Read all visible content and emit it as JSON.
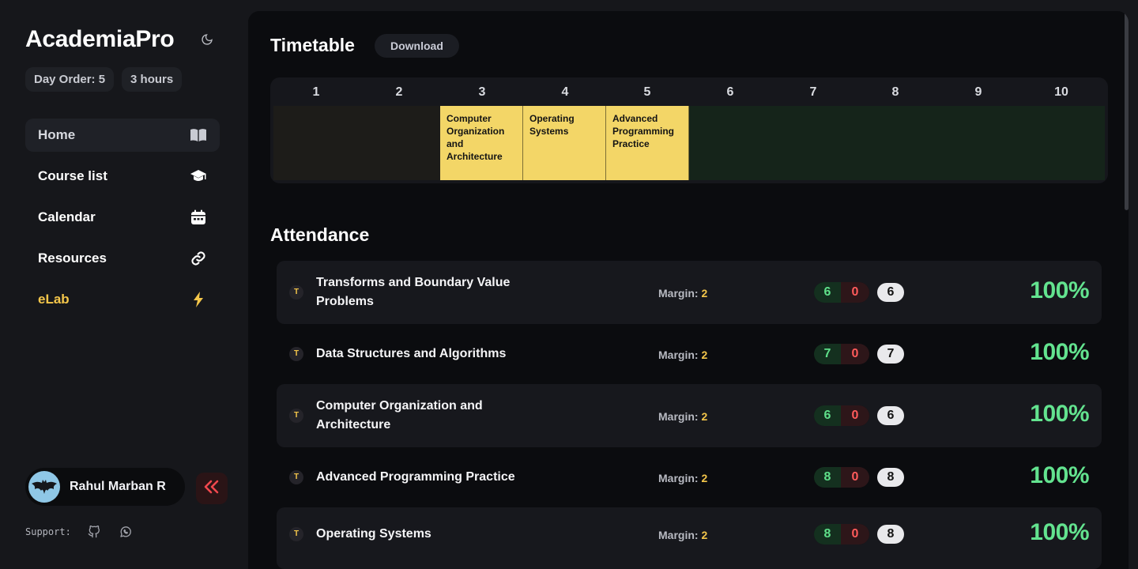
{
  "app": {
    "title": "AcademiaPro"
  },
  "status": {
    "day_order": "Day Order: 5",
    "hours": "3 hours"
  },
  "nav": {
    "items": [
      {
        "label": "Home",
        "icon": "book-open-icon"
      },
      {
        "label": "Course list",
        "icon": "graduation-cap-icon"
      },
      {
        "label": "Calendar",
        "icon": "calendar-icon"
      },
      {
        "label": "Resources",
        "icon": "link-icon"
      },
      {
        "label": "eLab",
        "icon": "lightning-icon"
      }
    ]
  },
  "user": {
    "name": "Rahul Marban R"
  },
  "support": {
    "label": "Support:"
  },
  "timetable": {
    "title": "Timetable",
    "download_label": "Download",
    "periods": [
      "1",
      "2",
      "3",
      "4",
      "5",
      "6",
      "7",
      "8",
      "9",
      "10"
    ],
    "classes": [
      {
        "period": 3,
        "name": "Computer Organization and Architecture"
      },
      {
        "period": 4,
        "name": "Operating Systems"
      },
      {
        "period": 5,
        "name": "Advanced Programming Practice"
      }
    ]
  },
  "attendance": {
    "title": "Attendance",
    "margin_label": "Margin:",
    "courses": [
      {
        "type": "T",
        "name": "Transforms and Boundary Value Problems",
        "margin": "2",
        "present": "6",
        "absent": "0",
        "total": "6",
        "percent": "100%"
      },
      {
        "type": "T",
        "name": "Data Structures and Algorithms",
        "margin": "2",
        "present": "7",
        "absent": "0",
        "total": "7",
        "percent": "100%"
      },
      {
        "type": "T",
        "name": "Computer Organization and Architecture",
        "margin": "2",
        "present": "6",
        "absent": "0",
        "total": "6",
        "percent": "100%"
      },
      {
        "type": "T",
        "name": "Advanced Programming Practice",
        "margin": "2",
        "present": "8",
        "absent": "0",
        "total": "8",
        "percent": "100%"
      },
      {
        "type": "T",
        "name": "Operating Systems",
        "margin": "2",
        "present": "8",
        "absent": "0",
        "total": "8",
        "percent": "100%"
      }
    ]
  },
  "colors": {
    "accent": "#f4c64a",
    "present": "#5fe08a",
    "absent": "#ff5b5b",
    "class_cell": "#f3d667"
  }
}
